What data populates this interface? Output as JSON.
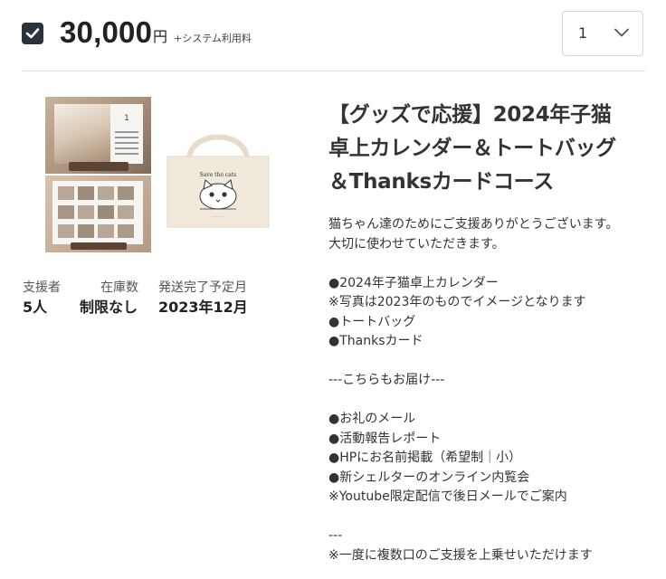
{
  "reward": {
    "selected": true,
    "price": "30,000",
    "currency": "円",
    "fee_note": "+システム利用料",
    "quantity": "1"
  },
  "image": {
    "tote_print": "Save the cats"
  },
  "stats": {
    "supporters_label": "支援者",
    "supporters_value": "5人",
    "stock_label": "在庫数",
    "stock_value": "制限なし",
    "delivery_label": "発送完了予定月",
    "delivery_value": "2023年12月"
  },
  "title_lines": [
    "【グッズで応援】2024年子猫",
    "卓上カレンダー＆トートバッグ",
    "＆Thanksカードコース"
  ],
  "description_lines": [
    "猫ちゃん達のためにご支援ありがとうございます。",
    "大切に使わせていただきます。",
    "●2024年子猫卓上カレンダー",
    "※写真は2023年のものでイメージとなります",
    "●トートバッグ",
    "●Thanksカード",
    "---こちらもお届け---",
    "●お礼のメール",
    "●活動報告レポート",
    "●HPにお名前掲載（希望制｜小）",
    "●新シェルターのオンライン内覧会",
    "※Youtube限定配信で後日メールでご案内",
    "---",
    "※一度に複数口のご支援を上乗せいただけます"
  ],
  "colors": {
    "checkbox": "#2c3338",
    "divider": "#dedede",
    "text": "#333333"
  }
}
